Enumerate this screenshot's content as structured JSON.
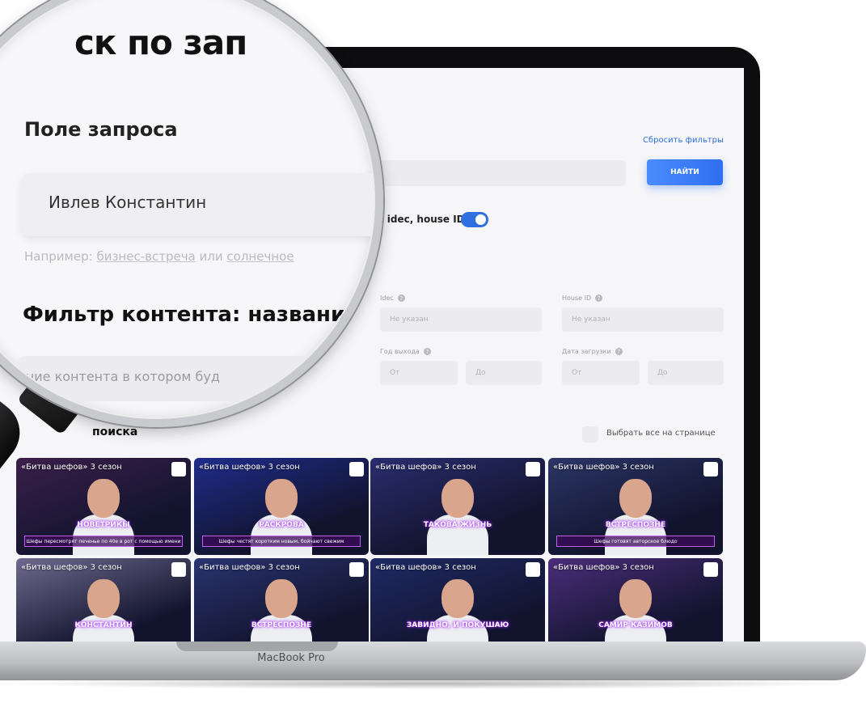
{
  "page": {
    "title_fragment": "ск по зап",
    "reset_filters": "Сбросить фильтры",
    "find_button": "НАЙТИ",
    "toggle_label": ", idec, house ID",
    "query_label": "Поле запроса",
    "query_value": "Ивлев Константин",
    "example_prefix": "Например:",
    "example_link_1": "бизнес-встреча",
    "example_or": "или",
    "example_link_2": "солнечное",
    "filter_title": "Фильтр контента: названи",
    "filter_placeholder": "ание контента в котором буд",
    "results_title": "поиска",
    "select_all": "Выбрать все на странице"
  },
  "filters": {
    "idec_label": "Idec",
    "idec_placeholder": "Не указан",
    "house_label": "House ID",
    "house_placeholder": "Не указан",
    "year_label": "Год выхода",
    "upload_label": "Дата загрузки",
    "from": "От",
    "to": "До"
  },
  "thumbnails": [
    {
      "title": "«Битва шефов» 3 сезон",
      "banner": "НОВЕТРИКЫ",
      "caption": "Шефы пересмотрят печенье по 40е в рот с помощью имени",
      "bg": "#3b1f4a"
    },
    {
      "title": "«Битва шефов» 3 сезон",
      "banner": "РАСКРОВА",
      "caption": "Шефы честят коротким новым, бойчают свежим",
      "bg": "#1f2c8a"
    },
    {
      "title": "«Битва шефов» 3 сезон",
      "banner": "ТАКОВА ЖИЗНЬ",
      "caption": "",
      "bg": "#2a2d6e"
    },
    {
      "title": "«Битва шефов» 3 сезон",
      "banner": "ВСТРЕСПОЗНЕ",
      "caption": "Шефы готовят авторское блюдо",
      "bg": "#2b3566"
    },
    {
      "title": "«Битва шефов» 3 сезон",
      "banner": "КОНСТАНТИН",
      "caption": "",
      "bg": "#6f6a8e"
    },
    {
      "title": "«Битва шефов» 3 сезон",
      "banner": "ВСТРЕСПОЗНЕ",
      "caption": "",
      "bg": "#2a3470"
    },
    {
      "title": "«Битва шефов» 3 сезон",
      "banner": "ЗАВИДНО, И ПОКУШАЮ",
      "caption": "",
      "bg": "#1f2a66"
    },
    {
      "title": "«Битва шефов» 3 сезон",
      "banner": "САМИР КАЗИМОВ",
      "caption": "",
      "bg": "#4a2d7a"
    }
  ],
  "laptop": {
    "model": "MacBook Pro"
  },
  "colors": {
    "accent": "#2f6fe0",
    "neon": "#b033ff"
  }
}
